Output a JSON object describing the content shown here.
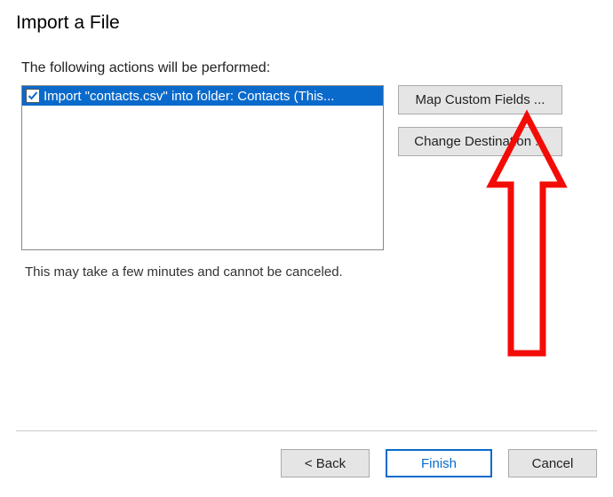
{
  "title": "Import a File",
  "actions_label": "The following actions will be performed:",
  "list": {
    "items": [
      {
        "checked": true,
        "label": "Import \"contacts.csv\" into folder: Contacts (This..."
      }
    ]
  },
  "side_buttons": {
    "map_fields": "Map Custom Fields ...",
    "change_destination": "Change Destination ..."
  },
  "note": "This may take a few minutes and cannot be canceled.",
  "nav": {
    "back": "< Back",
    "finish": "Finish",
    "cancel": "Cancel"
  },
  "colors": {
    "highlight": "#0a6acc",
    "annotation": "#f30c06"
  }
}
